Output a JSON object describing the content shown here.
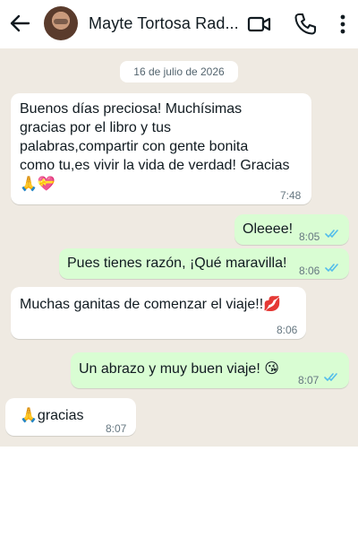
{
  "header": {
    "contact_name": "Mayte Tortosa Rad...",
    "icons": [
      "back-arrow-icon",
      "avatar",
      "video-call-icon",
      "phone-icon",
      "more-options-icon"
    ]
  },
  "chat": {
    "date": "16 de julio de 2026",
    "messages": [
      {
        "direction": "incoming",
        "lines": [
          "Buenos días preciosa! Muchísimas",
          "gracias por el libro y tus",
          "palabras,compartir con gente bonita",
          "como tu,es vivir la vida de verdad! Gracias",
          "🙏💝"
        ],
        "time": "7:48"
      },
      {
        "direction": "outgoing",
        "text": "Oleeee!",
        "time": "8:05",
        "status": "read"
      },
      {
        "direction": "outgoing",
        "text": "Pues tienes razón, ¡Qué maravilla!",
        "time": "8:06",
        "status": "read"
      },
      {
        "direction": "incoming",
        "text": "Muchas ganitas de comenzar el viaje!!💋",
        "time": "8:06"
      },
      {
        "direction": "outgoing",
        "text": "Un abrazo y muy buen viaje! 😘",
        "time": "8:07",
        "status": "read"
      },
      {
        "direction": "incoming",
        "text": "🙏gracias",
        "time": "8:07"
      }
    ]
  },
  "colors": {
    "chat_background": "#efeae2",
    "incoming_bubble": "#ffffff",
    "outgoing_bubble": "#d9fdd3",
    "read_ticks": "#53bdeb"
  }
}
